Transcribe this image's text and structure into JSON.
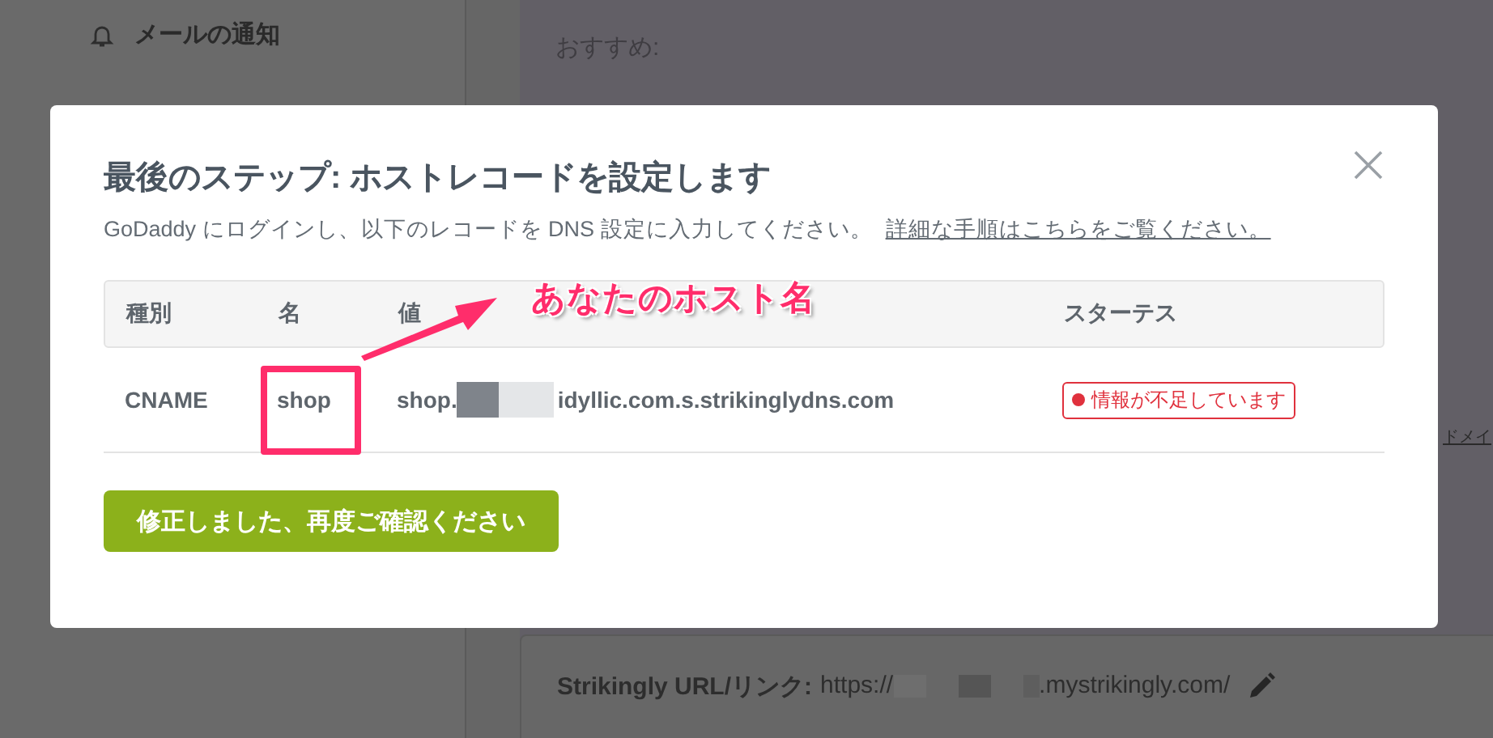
{
  "sidebar": {
    "items": [
      {
        "label": "メールの通知"
      }
    ]
  },
  "main": {
    "recommend_label": "おすすめ:",
    "side_text": "ドメイ"
  },
  "url_card": {
    "label": "Strikingly URL/リンク:",
    "prefix": "https://",
    "suffix": ".mystrikingly.com/"
  },
  "modal": {
    "title": "最後のステップ: ホストレコードを設定します",
    "instruction": "GoDaddy にログインし、以下のレコードを DNS 設定に入力してください。",
    "help_link": "詳細な手順はこちらをご覧ください。",
    "table": {
      "columns": [
        "種別",
        "名",
        "値",
        "スターテス"
      ],
      "rows": [
        {
          "type": "CNAME",
          "name": "shop",
          "value_prefix": "shop.",
          "value_suffix": "idyllic.com.s.strikinglydns.com",
          "status": {
            "kind": "error",
            "text": "情報が不足しています"
          }
        }
      ]
    },
    "button": "修正しました、再度ご確認ください"
  },
  "annotation": {
    "label": "あなたのホスト名"
  }
}
